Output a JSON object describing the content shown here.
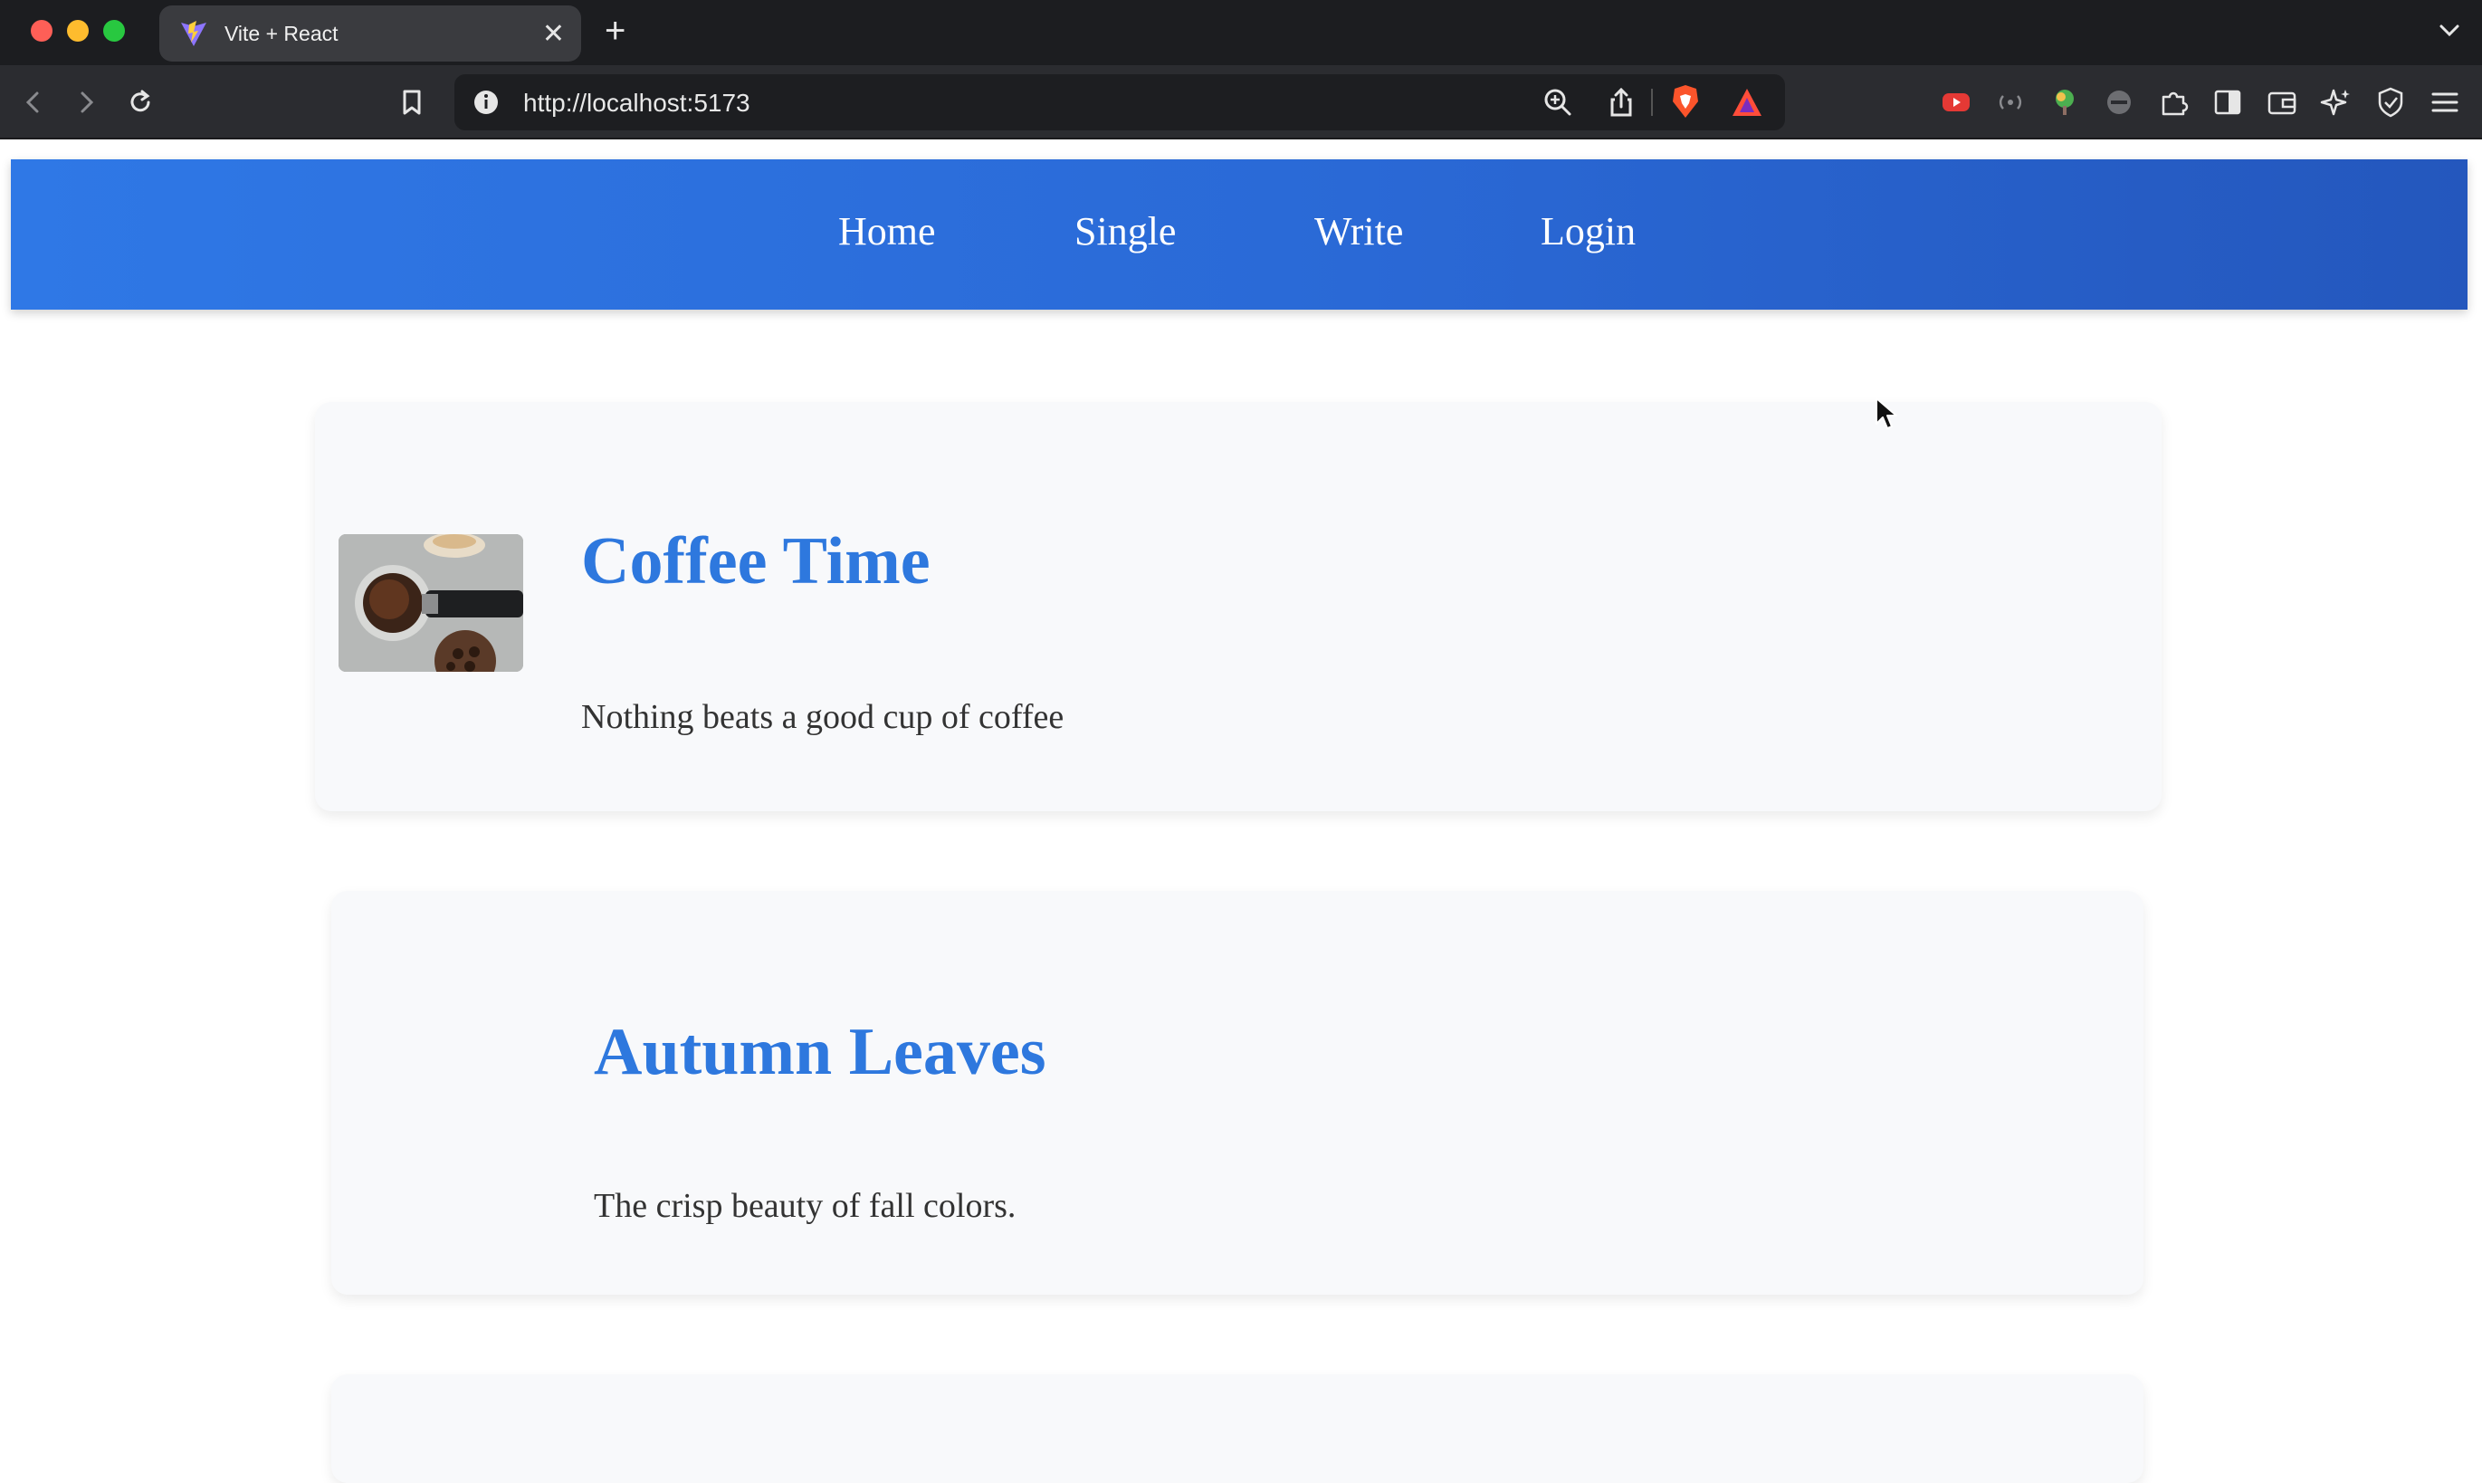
{
  "browser": {
    "tab_title": "Vite + React",
    "tab_close": "✕",
    "new_tab": "+",
    "url": "http://localhost:5173"
  },
  "nav": {
    "items": [
      "Home",
      "Single",
      "Write",
      "Login"
    ]
  },
  "posts": [
    {
      "title": "Coffee Time",
      "description": "Nothing beats a good cup of coffee",
      "has_image": true
    },
    {
      "title": "Autumn Leaves",
      "description": "The crisp beauty of fall colors.",
      "has_image": false
    }
  ],
  "colors": {
    "nav_gradient_start": "#2f78e6",
    "nav_gradient_end": "#2457bd",
    "post_title": "#2e78de",
    "card_background": "#f8f9fb"
  }
}
